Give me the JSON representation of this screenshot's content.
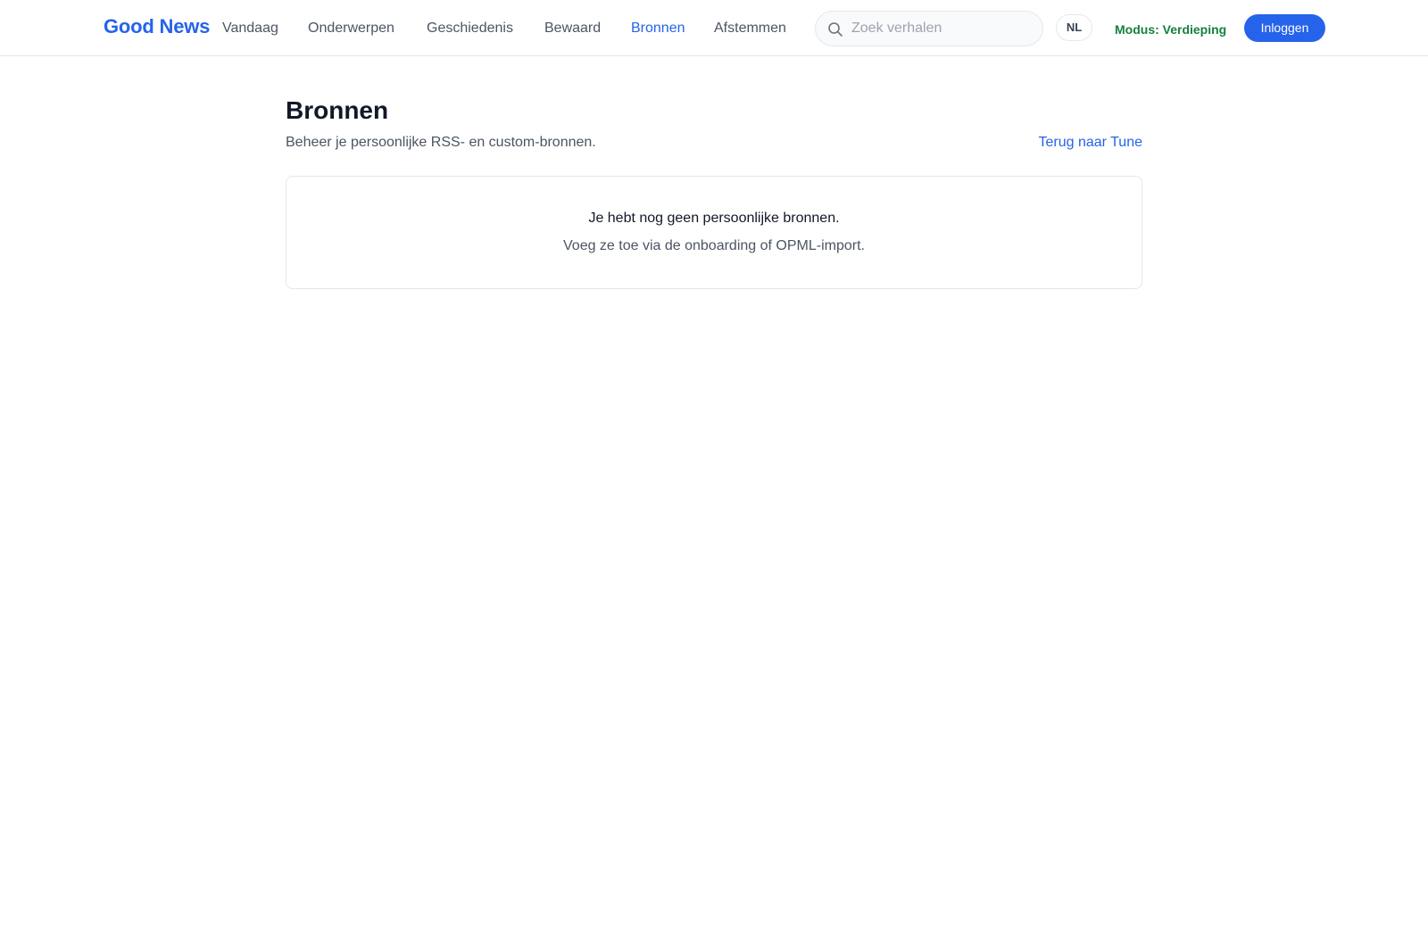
{
  "header": {
    "logo": "Good News",
    "nav": [
      {
        "label": "Vandaag",
        "active": false
      },
      {
        "label": "Onderwerpen",
        "active": false
      },
      {
        "label": "Geschiedenis",
        "active": false
      },
      {
        "label": "Bewaard",
        "active": false
      },
      {
        "label": "Bronnen",
        "active": true
      },
      {
        "label": "Afstemmen",
        "active": false
      }
    ],
    "search": {
      "placeholder": "Zoek verhalen",
      "value": "",
      "icon": "search-icon"
    },
    "language": "NL",
    "mode": "Modus: Verdieping",
    "login": "Inloggen"
  },
  "main": {
    "title": "Bronnen",
    "subtitle": "Beheer je persoonlijke RSS- en custom-bronnen.",
    "back_link": "Terug naar Tune",
    "empty_state": {
      "title": "Je hebt nog geen persoonlijke bronnen.",
      "text": "Voeg ze toe via de onboarding of OPML-import."
    }
  },
  "colors": {
    "accent": "#2563eb",
    "mode": "#15803d",
    "border": "#e5e7eb",
    "muted_text": "#4b5563"
  }
}
